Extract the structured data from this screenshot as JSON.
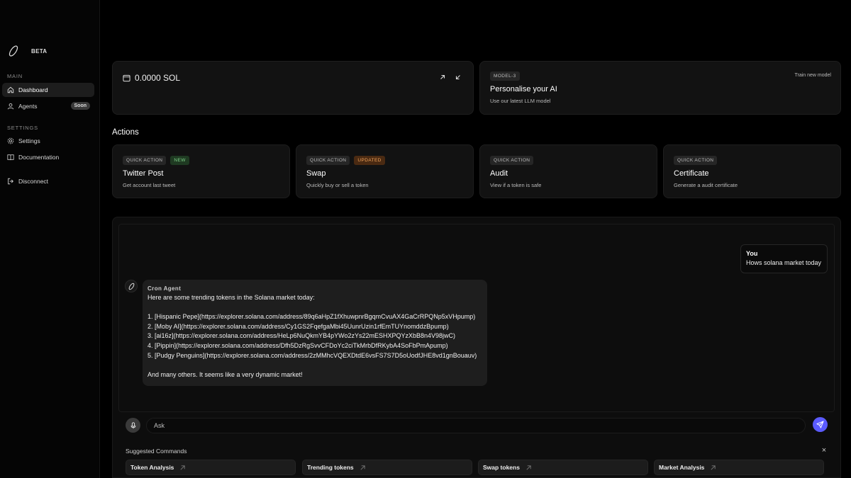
{
  "sidebar": {
    "beta": "BETA",
    "main_label": "MAIN",
    "settings_label": "SETTINGS",
    "items": [
      {
        "label": "Dashboard",
        "icon": "home-icon",
        "active": true
      },
      {
        "label": "Agents",
        "icon": "user-icon",
        "badge": "Soon"
      },
      {
        "label": "Settings",
        "icon": "gear-icon"
      },
      {
        "label": "Documentation",
        "icon": "book-icon"
      },
      {
        "label": "Disconnect",
        "icon": "logout-icon"
      }
    ]
  },
  "wallet": {
    "balance": "0.0000 SOL"
  },
  "model": {
    "tag": "MODEL-3",
    "train": "Train new model",
    "title": "Personalise your AI",
    "subtitle": "Use our latest LLM model"
  },
  "actions": {
    "title": "Actions",
    "cards": [
      {
        "tag": "QUICK ACTION",
        "badge": "NEW",
        "title": "Twitter Post",
        "subtitle": "Get account last tweet"
      },
      {
        "tag": "QUICK ACTION",
        "badge": "UPDATED",
        "title": "Swap",
        "subtitle": "Quickly buy or sell a token"
      },
      {
        "tag": "QUICK ACTION",
        "title": "Audit",
        "subtitle": "View if a token is safe"
      },
      {
        "tag": "QUICK ACTION",
        "title": "Certificate",
        "subtitle": "Generate a audit certificate"
      }
    ]
  },
  "chat": {
    "user": {
      "name": "You",
      "message": "Hows solana market today"
    },
    "agent": {
      "name": "Cron Agent",
      "intro": "Here are some trending tokens in the Solana market today:",
      "items": [
        "1. [Hispanic Pepe](https://explorer.solana.com/address/89q6aHpZ1fXhuwpnrBgqmCvuAX4GaCrRPQNp5xVHpump)",
        "2. [Moby AI](https://explorer.solana.com/address/Cy1GS2FqefgaMbi45UunrUzin1rfEmTUYnomddzBpump)",
        "3. [ai16z](https://explorer.solana.com/address/HeLp6NuQkmYB4pYWo2zYs22mESHXPQYzXbB8n4V98jwC)",
        "4. [Pippin](https://explorer.solana.com/address/Dfh5DzRgSvvCFDoYc2ciTkMrbDfRKybA4SoFbPmApump)",
        "5. [Pudgy Penguins](https://explorer.solana.com/address/2zMMhcVQEXDtdE6vsFS7S7D5oUodfJHE8vd1gnBouauv)"
      ],
      "outro": "And many others. It seems like a very dynamic market!"
    },
    "input_placeholder": "Ask"
  },
  "suggestions": {
    "title": "Suggested Commands",
    "close": "×",
    "items": [
      "Token Analysis",
      "Trending tokens",
      "Swap tokens",
      "Market Analysis"
    ]
  },
  "colors": {
    "accent": "#5b5bff",
    "new": "#7fd38a",
    "updated": "#f0a25a"
  }
}
